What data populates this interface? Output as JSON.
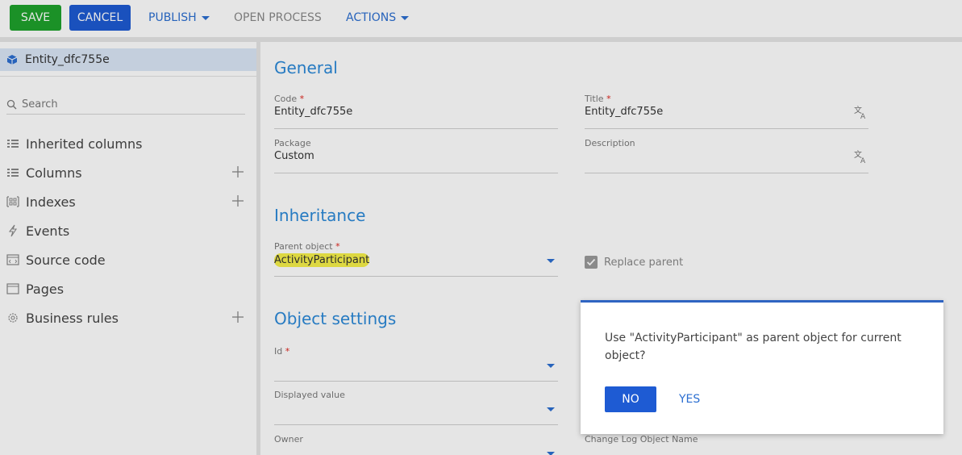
{
  "toolbar": {
    "save": "SAVE",
    "cancel": "CANCEL",
    "publish": "PUBLISH",
    "open_process": "OPEN PROCESS",
    "actions": "ACTIONS"
  },
  "sidebar": {
    "entity_name": "Entity_dfc755e",
    "search_placeholder": "Search",
    "items": [
      {
        "label": "Inherited columns",
        "icon": "columns-icon"
      },
      {
        "label": "Columns",
        "icon": "columns-icon",
        "add": true
      },
      {
        "label": "Indexes",
        "icon": "indexes-icon",
        "add": true
      },
      {
        "label": "Events",
        "icon": "lightning-icon"
      },
      {
        "label": "Source code",
        "icon": "code-icon"
      },
      {
        "label": "Pages",
        "icon": "page-icon"
      },
      {
        "label": "Business rules",
        "icon": "gear-icon",
        "add": true
      }
    ]
  },
  "main": {
    "general_title": "General",
    "code": {
      "label": "Code",
      "value": "Entity_dfc755e"
    },
    "title": {
      "label": "Title",
      "value": "Entity_dfc755e"
    },
    "package": {
      "label": "Package",
      "value": "Custom"
    },
    "description": {
      "label": "Description",
      "value": ""
    },
    "inheritance_title": "Inheritance",
    "parent_object": {
      "label": "Parent object",
      "value": "ActivityParticipant"
    },
    "replace_parent": "Replace parent",
    "object_settings_title": "Object settings",
    "id": {
      "label": "Id",
      "value": ""
    },
    "displayed_value": {
      "label": "Displayed value",
      "value": ""
    },
    "owner": {
      "label": "Owner",
      "value": ""
    },
    "change_log_label": "Change Log Object Name"
  },
  "dialog": {
    "message": "Use \"ActivityParticipant\" as parent object for current object?",
    "no": "NO",
    "yes": "YES"
  },
  "colors": {
    "save_green": "#1fa22c",
    "primary_blue": "#1e5bd3",
    "link_blue": "#2c6fd1",
    "section_blue": "#2c8ad9",
    "highlight_yellow": "#f7f14a"
  }
}
